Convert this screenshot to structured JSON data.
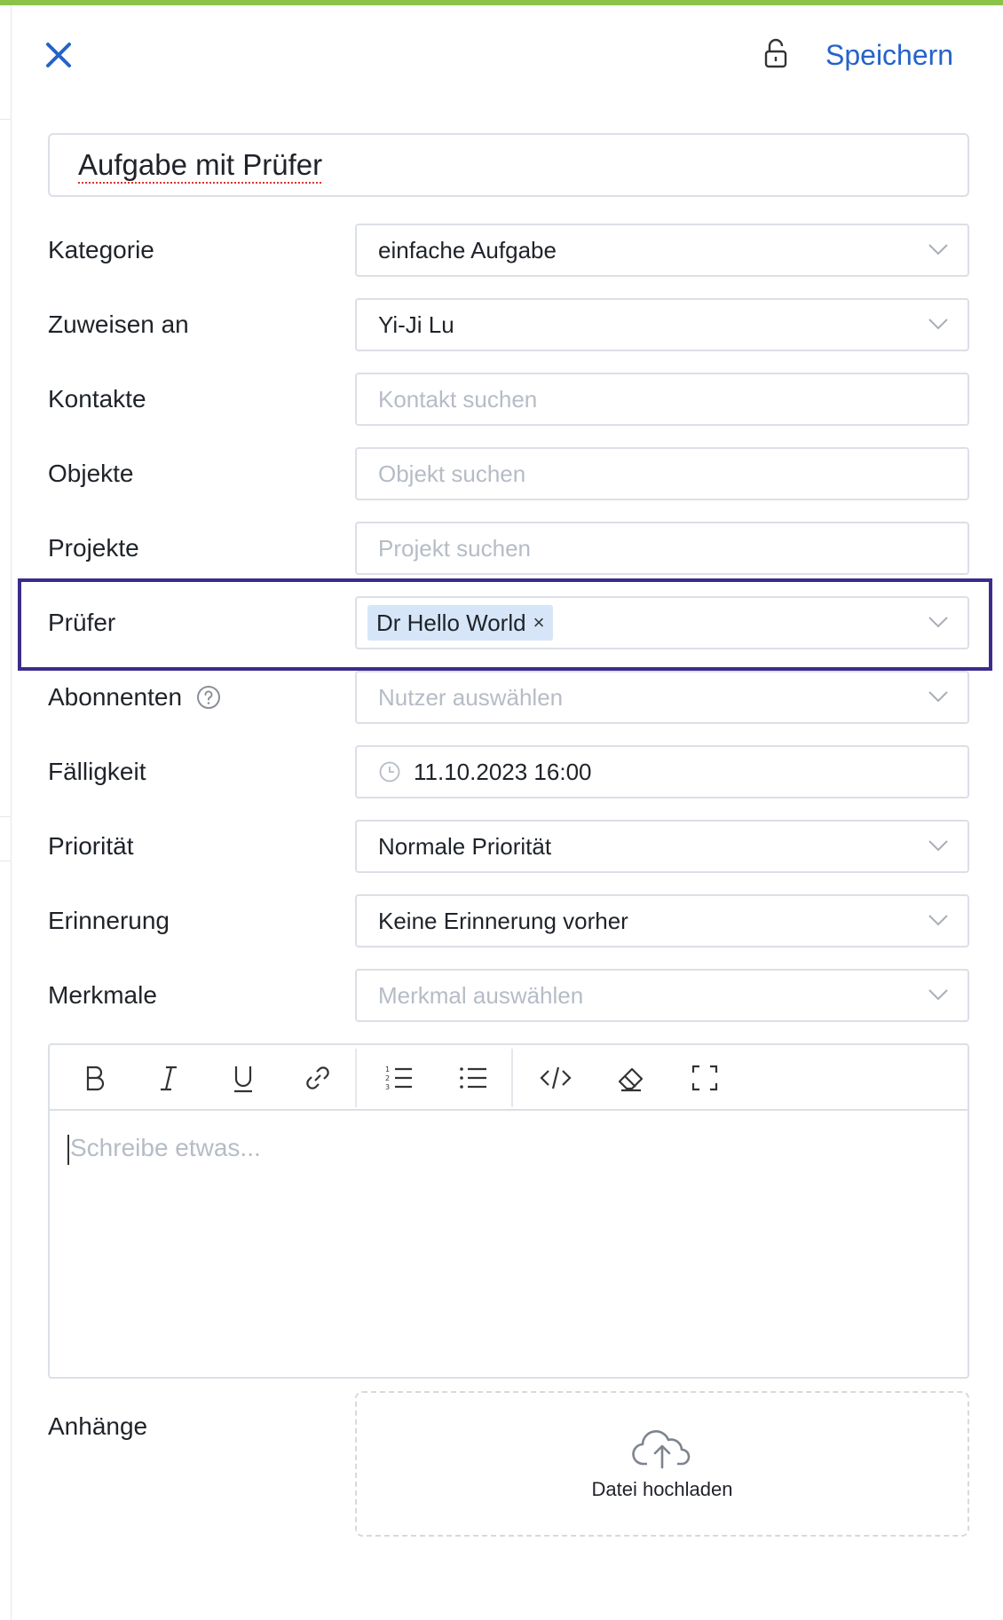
{
  "header": {
    "save_label": "Speichern"
  },
  "task": {
    "title": "Aufgabe mit Prüfer"
  },
  "fields": {
    "kategorie": {
      "label": "Kategorie",
      "value": "einfache Aufgabe"
    },
    "zuweisen": {
      "label": "Zuweisen an",
      "value": "Yi-Ji Lu"
    },
    "kontakte": {
      "label": "Kontakte",
      "placeholder": "Kontakt suchen"
    },
    "objekte": {
      "label": "Objekte",
      "placeholder": "Objekt suchen"
    },
    "projekte": {
      "label": "Projekte",
      "placeholder": "Projekt suchen"
    },
    "pruefer": {
      "label": "Prüfer",
      "tag": "Dr Hello World",
      "tag_remove": "×"
    },
    "abonnenten": {
      "label": "Abonnenten",
      "placeholder": "Nutzer auswählen"
    },
    "faelligkeit": {
      "label": "Fälligkeit",
      "value": "11.10.2023 16:00"
    },
    "prioritaet": {
      "label": "Priorität",
      "value": "Normale Priorität"
    },
    "erinnerung": {
      "label": "Erinnerung",
      "value": "Keine Erinnerung vorher"
    },
    "merkmale": {
      "label": "Merkmale",
      "placeholder": "Merkmal auswählen"
    }
  },
  "editor": {
    "placeholder": "Schreibe etwas...",
    "toolbar": [
      "bold-icon",
      "italic-icon",
      "underline-icon",
      "link-icon",
      "ordered-list-icon",
      "bullet-list-icon",
      "code-icon",
      "eraser-icon",
      "fullscreen-icon"
    ]
  },
  "attachments": {
    "label": "Anhänge",
    "upload_label": "Datei hochladen"
  },
  "colors": {
    "accent": "#2563c9",
    "top_bar": "#8bc34a",
    "highlight_border": "#3d2b8c",
    "tag_bg": "#d6e6f8",
    "border": "#dcdfe6",
    "placeholder": "#b6bcc6"
  }
}
